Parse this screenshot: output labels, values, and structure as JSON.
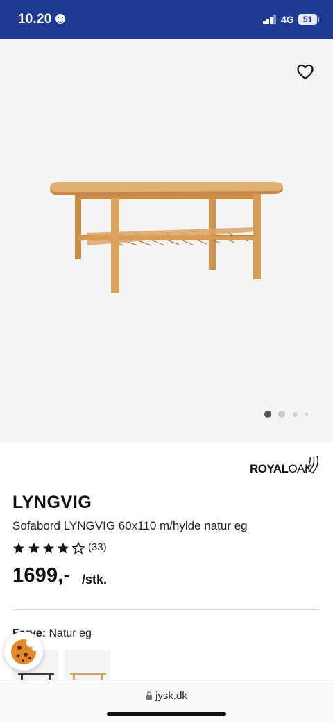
{
  "status_bar": {
    "time": "10.20",
    "network": "4G",
    "battery": "51"
  },
  "gallery": {
    "slide_count": 4,
    "active_slide": 1
  },
  "brand": {
    "name_bold": "ROYAL",
    "name_light": "OAK"
  },
  "product": {
    "name": "LYNGVIG",
    "description": "Sofabord LYNGVIG 60x110 m/hylde natur eg",
    "rating": 4.5,
    "review_count": "(33)",
    "price": "1699,-",
    "unit": "/stk."
  },
  "color": {
    "label": "Farve:",
    "value": "Natur eg"
  },
  "browser": {
    "url": "jysk.dk"
  },
  "icons": {
    "wishlist": "heart-outline-icon",
    "cookie": "cookie-icon",
    "lock": "lock-icon"
  },
  "colors": {
    "status_bar_bg": "#1f3a93",
    "gallery_bg": "#f4f4f4",
    "wood": "#d9a35c"
  }
}
